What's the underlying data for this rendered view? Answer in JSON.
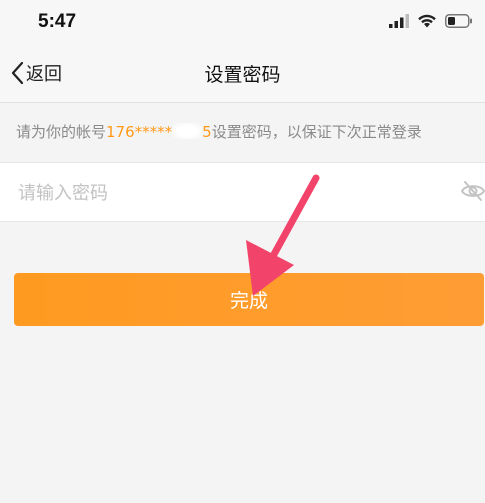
{
  "status_bar": {
    "time": "5:47"
  },
  "nav": {
    "back_label": "返回",
    "title": "设置密码"
  },
  "hint": {
    "before": "请为你的帐号",
    "account_masked": "176*****",
    "account_tail": "5",
    "after": "设置密码，以保证下次正常登录"
  },
  "password_field": {
    "placeholder": "请输入密码",
    "value": ""
  },
  "submit": {
    "label": "完成"
  },
  "colors": {
    "accent": "#ff9a1a",
    "button": "#ff9a20",
    "annotation_arrow": "#f2446a"
  }
}
